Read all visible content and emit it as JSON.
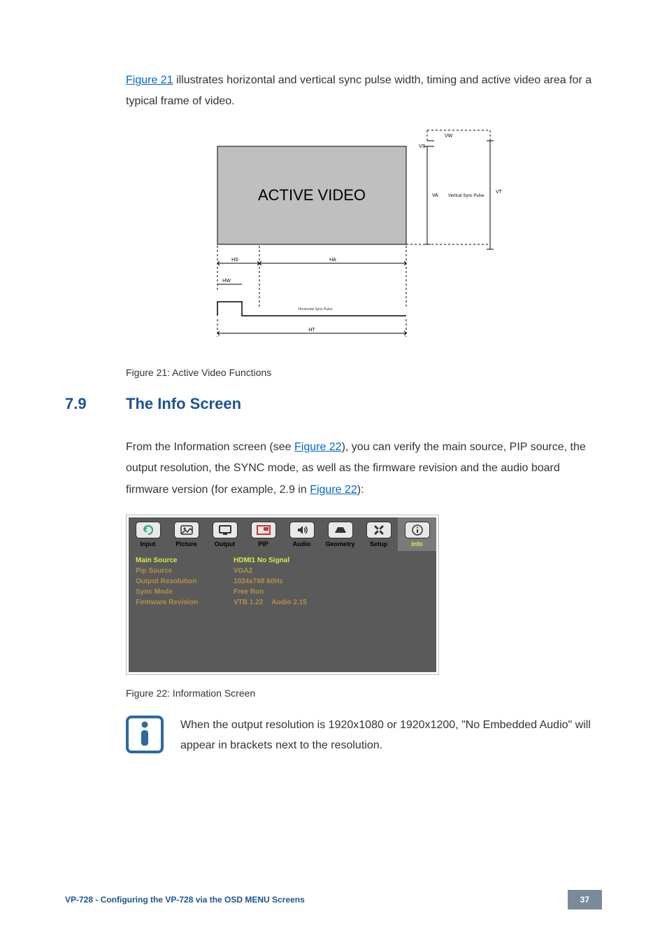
{
  "intro": {
    "link_fig21": "Figure 21",
    "sentence": " illustrates horizontal and vertical sync pulse width, timing and active video area for a typical frame of video."
  },
  "fig21": {
    "active_video": "ACTIVE VIDEO",
    "vw": "VW",
    "vs": "VS",
    "vt": "VT",
    "va": "VA",
    "vert_pulse": "Vertical Sync Pulse",
    "hs": "HS",
    "ha": "HA",
    "hw": "HW",
    "ht": "HT",
    "horiz_pulse": "Horizontal Sync Pulse",
    "caption": "Figure 21: Active Video Functions"
  },
  "section": {
    "number": "7.9",
    "title": "The Info Screen"
  },
  "para2": {
    "pre": "From the Information screen (see ",
    "link1": "Figure 22",
    "mid": "), you can verify the main source, PIP source, the output resolution, the SYNC mode, as well as the firmware revision and the audio board firmware version (for example, 2.9 in ",
    "link2": "Figure 22",
    "post": "):"
  },
  "osd": {
    "tabs": {
      "input": "Input",
      "picture": "Picture",
      "output": "Output",
      "pip": "PIP",
      "audio": "Audio",
      "geometry": "Geometry",
      "setup": "Setup",
      "info": "Info"
    },
    "rows": {
      "main_source_k": "Main Source",
      "main_source_v": "HDMI1 No Signal",
      "pip_source_k": "Pip Source",
      "pip_source_v": "VGA2",
      "output_res_k": "Output Resolution",
      "output_res_v": "1024x768 60Hz",
      "sync_mode_k": "Sync Mode",
      "sync_mode_v": "Free Run",
      "firmware_k": "Firmware Revision",
      "firmware_v": "VTB 1.22",
      "firmware_extra": "Audio 2.15"
    }
  },
  "fig22": {
    "caption": "Figure 22: Information Screen"
  },
  "note": {
    "text": "When the output resolution is 1920x1080 or 1920x1200, \"No Embedded Audio\" will appear in brackets next to the resolution."
  },
  "footer": {
    "title": "VP-728 - Configuring the VP-728 via the OSD MENU Screens",
    "page": "37"
  }
}
